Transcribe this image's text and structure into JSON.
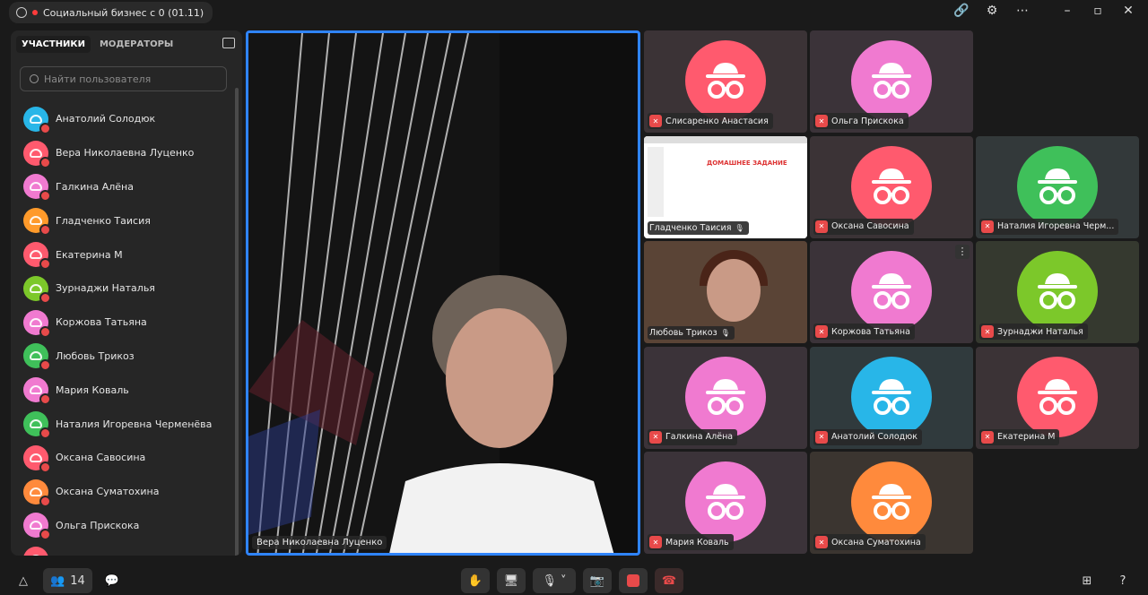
{
  "window": {
    "title": "Социальный бизнес с 0 (01.11)"
  },
  "sidebar": {
    "tabs": [
      {
        "label": "УЧАСТНИКИ"
      },
      {
        "label": "МОДЕРАТОРЫ"
      }
    ],
    "search_placeholder": "Найти пользователя",
    "participants": [
      {
        "name": "Анатолий Солодюк",
        "color": "#28b6e8"
      },
      {
        "name": "Вера Николаевна Луценко",
        "color": "#ff5a6e"
      },
      {
        "name": "Галкина Алёна",
        "color": "#f07ad0"
      },
      {
        "name": "Гладченко Таисия",
        "color": "#ff9a2a"
      },
      {
        "name": "Екатерина М",
        "color": "#ff5a6e"
      },
      {
        "name": "Зурнаджи Наталья",
        "color": "#7cc82a"
      },
      {
        "name": "Коржова Татьяна",
        "color": "#f07ad0"
      },
      {
        "name": "Любовь Трикоз",
        "color": "#3fc05a"
      },
      {
        "name": "Мария Коваль",
        "color": "#f07ad0"
      },
      {
        "name": "Наталия Игоревна Черменёва",
        "color": "#3fc05a"
      },
      {
        "name": "Оксана Савосина",
        "color": "#ff5a6e"
      },
      {
        "name": "Оксана Суматохина",
        "color": "#ff8a3c"
      },
      {
        "name": "Ольга Прискока",
        "color": "#f07ad0"
      },
      {
        "name": "",
        "color": "#ff5a6e"
      }
    ]
  },
  "main_video": {
    "name": "Вера Николаевна Луценко"
  },
  "tiles": [
    {
      "name": "Слисаренко Анастасия",
      "color": "#ff5a6e",
      "bg": "#3b3336"
    },
    {
      "name": "Ольга Прискока",
      "color": "#f07ad0",
      "bg": "#3b3339"
    },
    {
      "name": "Гладченко Таисия",
      "color": "",
      "bg": "#ffffff",
      "icon": "screen-share"
    },
    {
      "name": "Оксана Савосина",
      "color": "#ff5a6e",
      "bg": "#3b3336"
    },
    {
      "name": "Наталия Игоревна Черм...",
      "color": "#3fc05a",
      "bg": "#33393a"
    },
    {
      "name": "Любовь Трикоз",
      "color": "",
      "bg": "#3a2a22",
      "icon": "camera-video"
    },
    {
      "name": "Коржова Татьяна",
      "color": "#f07ad0",
      "bg": "#3b3339"
    },
    {
      "name": "Зурнаджи Наталья",
      "color": "#7cc82a",
      "bg": "#35392f"
    },
    {
      "name": "Галкина Алёна",
      "color": "#f07ad0",
      "bg": "#3b3339"
    },
    {
      "name": "Анатолий Солодюк",
      "color": "#28b6e8",
      "bg": "#303a3d"
    },
    {
      "name": "Екатерина М",
      "color": "#ff5a6e",
      "bg": "#3b3336"
    },
    {
      "name": "Мария Коваль",
      "color": "#f07ad0",
      "bg": "#3b3339"
    },
    {
      "name": "Оксана Суматохина",
      "color": "#ff8a3c",
      "bg": "#3b3530"
    }
  ],
  "slide": {
    "title": "ДОМАШНЕЕ ЗАДАНИЕ"
  },
  "bottom": {
    "participants_count": "14"
  },
  "colors": {
    "accent": "#2f84ff",
    "muted": "#e84a4a",
    "end_call": "#e84a4a"
  }
}
